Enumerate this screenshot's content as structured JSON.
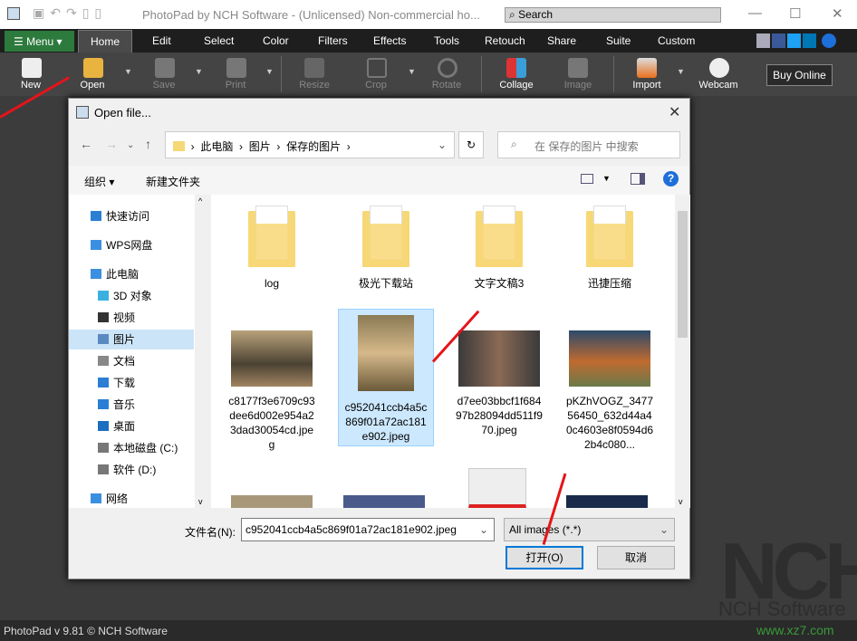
{
  "app": {
    "title": "PhotoPad by NCH Software - (Unlicensed) Non-commercial ho...",
    "search_placeholder": "Search",
    "status": "PhotoPad v 9.81 © NCH Software",
    "watermark": "NCH",
    "watermark_sub": "NCH Software",
    "site": "www.xz7.com"
  },
  "menu": {
    "menu_label": "Menu",
    "tabs": [
      "Home",
      "Edit",
      "Select",
      "Color",
      "Filters",
      "Effects",
      "Tools",
      "Retouch",
      "Share",
      "Suite",
      "Custom"
    ]
  },
  "toolbar": {
    "items": [
      {
        "label": "New",
        "enabled": true
      },
      {
        "label": "Open",
        "enabled": true
      },
      {
        "label": "Save",
        "enabled": false
      },
      {
        "label": "Print",
        "enabled": false
      },
      {
        "label": "Resize",
        "enabled": false
      },
      {
        "label": "Crop",
        "enabled": false
      },
      {
        "label": "Rotate",
        "enabled": false
      },
      {
        "label": "Collage",
        "enabled": true
      },
      {
        "label": "Image",
        "enabled": false
      },
      {
        "label": "Import",
        "enabled": true
      },
      {
        "label": "Webcam",
        "enabled": true
      }
    ],
    "buy": "Buy Online"
  },
  "dialog": {
    "title": "Open file...",
    "breadcrumb": [
      "此电脑",
      "图片",
      "保存的图片"
    ],
    "search_placeholder": "在 保存的图片 中搜索",
    "organize": "组织 ▾",
    "new_folder": "新建文件夹",
    "sidebar": [
      "快速访问",
      "WPS网盘",
      "此电脑",
      "3D 对象",
      "视频",
      "图片",
      "文档",
      "下载",
      "音乐",
      "桌面",
      "本地磁盘 (C:)",
      "软件 (D:)",
      "网络"
    ],
    "sidebar_selected": "图片",
    "files": [
      {
        "name": "log",
        "type": "folder"
      },
      {
        "name": "极光下载站",
        "type": "folder"
      },
      {
        "name": "文字文稿3",
        "type": "folder"
      },
      {
        "name": "迅捷压缩",
        "type": "folder"
      },
      {
        "name": "c8177f3e6709c93dee6d002e954a23dad30054cd.jpeg",
        "type": "image"
      },
      {
        "name": "c952041ccb4a5c869f01a72ac181e902.jpeg",
        "type": "image",
        "selected": true
      },
      {
        "name": "d7ee03bbcf1f68497b28094dd511f970.jpeg",
        "type": "image"
      },
      {
        "name": "pKZhVOGZ_347756450_632d44a40c4603e8f0594d62b4c080...",
        "type": "image"
      }
    ],
    "filename_label": "文件名(N):",
    "filename": "c952041ccb4a5c869f01a72ac181e902.jpeg",
    "filetype": "All images (*.*)",
    "open": "打开(O)",
    "cancel": "取消"
  }
}
